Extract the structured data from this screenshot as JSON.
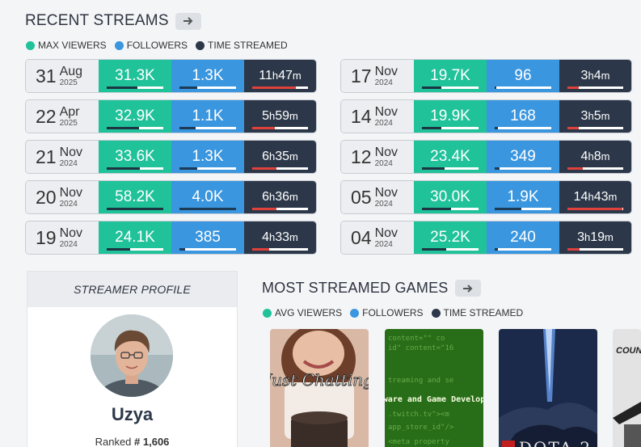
{
  "recent_streams": {
    "title": "RECENT STREAMS",
    "legend": [
      {
        "label": "MAX VIEWERS",
        "color": "#20c29a"
      },
      {
        "label": "FOLLOWERS",
        "color": "#3a96df"
      },
      {
        "label": "TIME STREAMED",
        "color": "#2c3849"
      }
    ],
    "rows": [
      {
        "day": "31",
        "month": "Aug",
        "year": "2025",
        "viewers": "31.3K",
        "viewers_pct": 0.54,
        "followers": "1.3K",
        "followers_pct": 0.32,
        "time_h": "11",
        "time_m": "47",
        "time_pct": 0.78
      },
      {
        "day": "22",
        "month": "Apr",
        "year": "2025",
        "viewers": "32.9K",
        "viewers_pct": 0.57,
        "followers": "1.1K",
        "followers_pct": 0.28,
        "time_h": "5",
        "time_m": "59",
        "time_pct": 0.4
      },
      {
        "day": "21",
        "month": "Nov",
        "year": "2024",
        "viewers": "33.6K",
        "viewers_pct": 0.58,
        "followers": "1.3K",
        "followers_pct": 0.32,
        "time_h": "6",
        "time_m": "35",
        "time_pct": 0.44
      },
      {
        "day": "20",
        "month": "Nov",
        "year": "2024",
        "viewers": "58.2K",
        "viewers_pct": 1.0,
        "followers": "4.0K",
        "followers_pct": 1.0,
        "time_h": "6",
        "time_m": "36",
        "time_pct": 0.44
      },
      {
        "day": "19",
        "month": "Nov",
        "year": "2024",
        "viewers": "24.1K",
        "viewers_pct": 0.41,
        "followers": "385",
        "followers_pct": 0.1,
        "time_h": "4",
        "time_m": "33",
        "time_pct": 0.3
      },
      {
        "day": "17",
        "month": "Nov",
        "year": "2024",
        "viewers": "19.7K",
        "viewers_pct": 0.34,
        "followers": "96",
        "followers_pct": 0.03,
        "time_h": "3",
        "time_m": "4",
        "time_pct": 0.21
      },
      {
        "day": "14",
        "month": "Nov",
        "year": "2024",
        "viewers": "19.9K",
        "viewers_pct": 0.34,
        "followers": "168",
        "followers_pct": 0.05,
        "time_h": "3",
        "time_m": "5",
        "time_pct": 0.21
      },
      {
        "day": "12",
        "month": "Nov",
        "year": "2024",
        "viewers": "23.4K",
        "viewers_pct": 0.4,
        "followers": "349",
        "followers_pct": 0.09,
        "time_h": "4",
        "time_m": "8",
        "time_pct": 0.28
      },
      {
        "day": "05",
        "month": "Nov",
        "year": "2024",
        "viewers": "30.0K",
        "viewers_pct": 0.52,
        "followers": "1.9K",
        "followers_pct": 0.47,
        "time_h": "14",
        "time_m": "43",
        "time_pct": 0.98
      },
      {
        "day": "04",
        "month": "Nov",
        "year": "2024",
        "viewers": "25.2K",
        "viewers_pct": 0.43,
        "followers": "240",
        "followers_pct": 0.06,
        "time_h": "3",
        "time_m": "19",
        "time_pct": 0.22
      }
    ]
  },
  "profile": {
    "header": "STREAMER PROFILE",
    "name": "Uzya",
    "rank_label": "Ranked",
    "rank_value": "# 1,606"
  },
  "most_streamed_games": {
    "title": "MOST STREAMED GAMES",
    "legend": [
      {
        "label": "AVG VIEWERS",
        "color": "#20c29a"
      },
      {
        "label": "FOLLOWERS",
        "color": "#3a96df"
      },
      {
        "label": "TIME STREAMED",
        "color": "#2c3849"
      }
    ],
    "games": [
      {
        "cover_text": "Just Chatting"
      },
      {
        "cover_text": "Software and Game Development"
      },
      {
        "cover_text": "DOTA 2"
      },
      {
        "cover_text": "COUNTER-STRIKE"
      }
    ]
  },
  "hour_suffix": "h",
  "minute_suffix": "m"
}
